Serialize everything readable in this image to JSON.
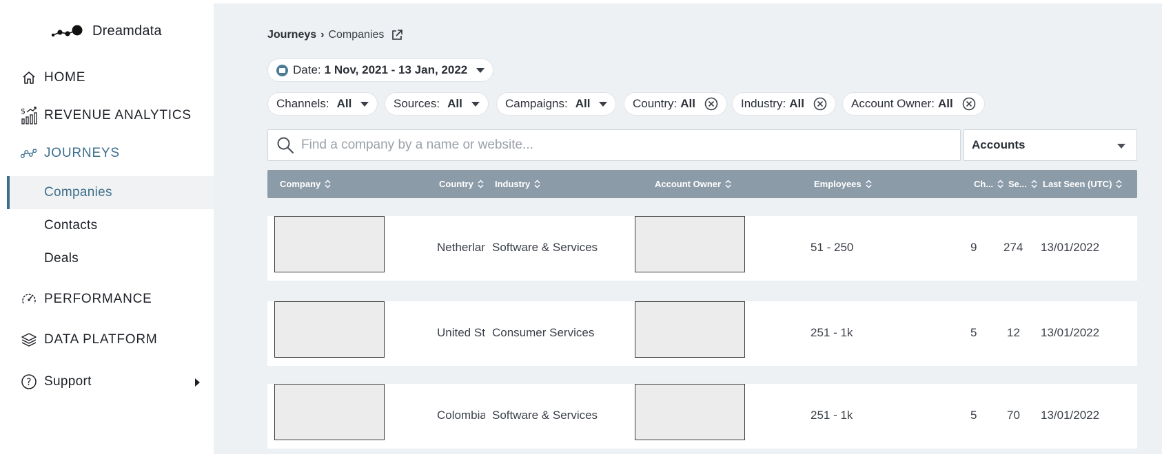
{
  "brand": {
    "name": "Dreamdata"
  },
  "nav": {
    "home": "HOME",
    "revenue": "REVENUE ANALYTICS",
    "journeys": "JOURNEYS",
    "sub": {
      "companies": "Companies",
      "contacts": "Contacts",
      "deals": "Deals"
    },
    "performance": "PERFORMANCE",
    "data_platform": "DATA PLATFORM",
    "support": "Support"
  },
  "breadcrumb": {
    "parent": "Journeys",
    "separator": "›",
    "current": "Companies"
  },
  "filters": {
    "date": {
      "label": "Date:",
      "value": "1 Nov, 2021 - 13 Jan, 2022"
    },
    "channels": {
      "label": "Channels:",
      "value": "All"
    },
    "sources": {
      "label": "Sources:",
      "value": "All"
    },
    "campaigns": {
      "label": "Campaigns:",
      "value": "All"
    },
    "country": {
      "label": "Country:",
      "value": "All"
    },
    "industry": {
      "label": "Industry:",
      "value": "All"
    },
    "account_owner": {
      "label": "Account Owner:",
      "value": "All"
    }
  },
  "search": {
    "placeholder": "Find a company by a name or website...",
    "value": ""
  },
  "view_select": {
    "value": "Accounts"
  },
  "table": {
    "columns": {
      "company": "Company",
      "country": "Country",
      "industry": "Industry",
      "owner": "Account Owner",
      "employees": "Employees",
      "channels": "Ch...",
      "sessions": "Se...",
      "last_seen": "Last Seen (UTC)"
    },
    "rows": [
      {
        "country": "Netherlands",
        "industry": "Software & Services",
        "employees": "51 - 250",
        "channels": "9",
        "sessions": "274",
        "last_seen": "13/01/2022"
      },
      {
        "country": "United States",
        "industry": "Consumer Services",
        "employees": "251 - 1k",
        "channels": "5",
        "sessions": "12",
        "last_seen": "13/01/2022"
      },
      {
        "country": "Colombia",
        "industry": "Software & Services",
        "employees": "251 - 1k",
        "channels": "5",
        "sessions": "70",
        "last_seen": "13/01/2022"
      }
    ]
  },
  "colors": {
    "accent": "#3d6f8c",
    "header_bg": "#8c9ba8",
    "main_bg": "#edf1f4"
  }
}
